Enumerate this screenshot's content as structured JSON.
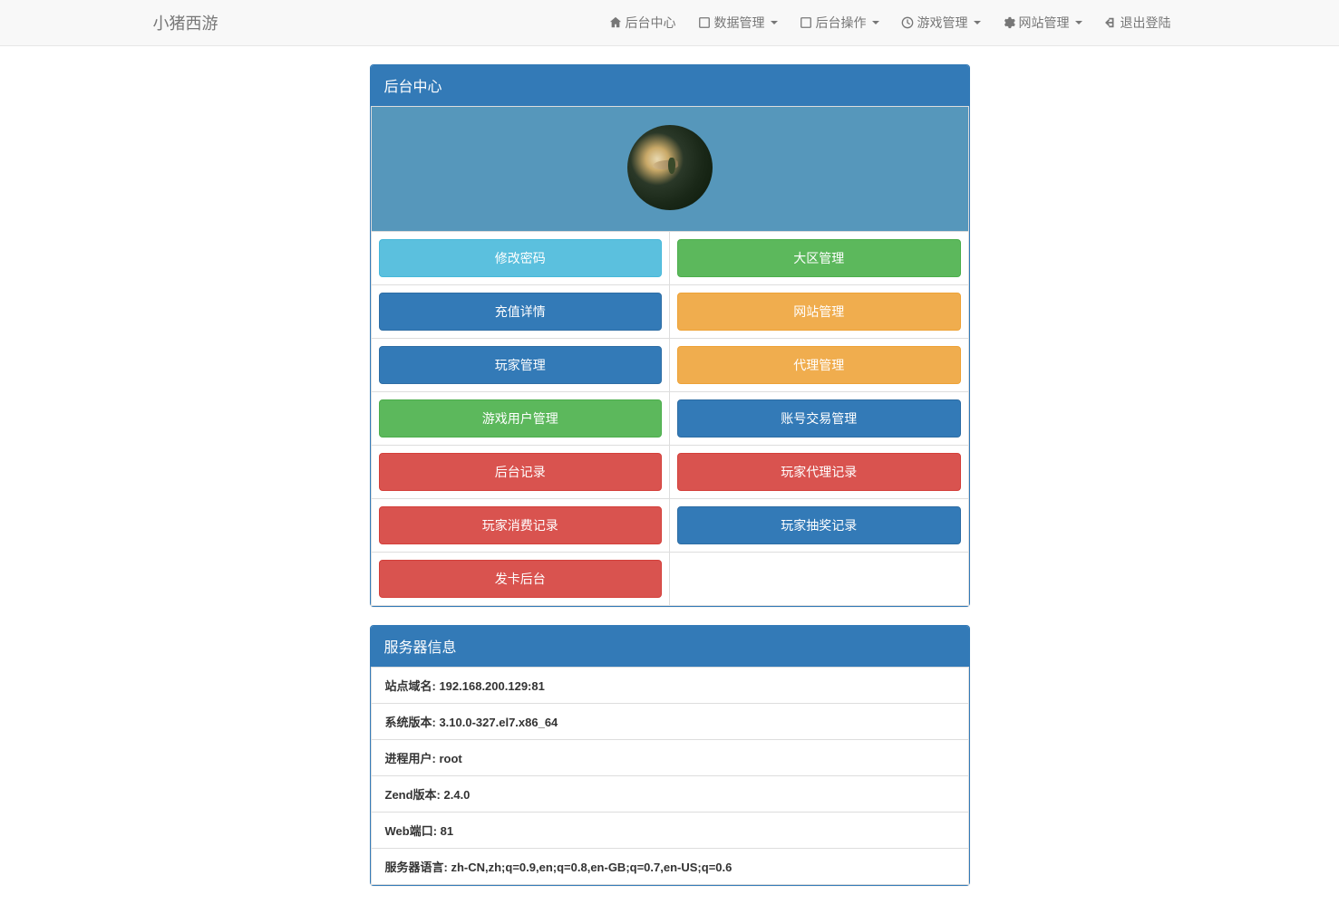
{
  "navbar": {
    "brand": "小猪西游",
    "items": [
      {
        "icon": "home",
        "label": "后台中心",
        "dropdown": false
      },
      {
        "icon": "unchecked",
        "label": "数据管理",
        "dropdown": true
      },
      {
        "icon": "unchecked",
        "label": "后台操作",
        "dropdown": true
      },
      {
        "icon": "time",
        "label": "游戏管理",
        "dropdown": true
      },
      {
        "icon": "cog",
        "label": "网站管理",
        "dropdown": true
      },
      {
        "icon": "logout",
        "label": "退出登陆",
        "dropdown": false
      }
    ]
  },
  "panel1": {
    "title": "后台中心",
    "buttons": [
      [
        {
          "label": "修改密码",
          "cls": "btn-info"
        },
        {
          "label": "大区管理",
          "cls": "btn-success"
        }
      ],
      [
        {
          "label": "充值详情",
          "cls": "btn-primary"
        },
        {
          "label": "网站管理",
          "cls": "btn-warning"
        }
      ],
      [
        {
          "label": "玩家管理",
          "cls": "btn-primary"
        },
        {
          "label": "代理管理",
          "cls": "btn-warning"
        }
      ],
      [
        {
          "label": "游戏用户管理",
          "cls": "btn-success"
        },
        {
          "label": "账号交易管理",
          "cls": "btn-primary"
        }
      ],
      [
        {
          "label": "后台记录",
          "cls": "btn-danger"
        },
        {
          "label": "玩家代理记录",
          "cls": "btn-danger"
        }
      ],
      [
        {
          "label": "玩家消费记录",
          "cls": "btn-danger"
        },
        {
          "label": "玩家抽奖记录",
          "cls": "btn-primary"
        }
      ],
      [
        {
          "label": "发卡后台",
          "cls": "btn-danger"
        },
        null
      ]
    ]
  },
  "panel2": {
    "title": "服务器信息",
    "items": [
      {
        "label": "站点域名: ",
        "value": "192.168.200.129:81"
      },
      {
        "label": "系统版本: ",
        "value": "3.10.0-327.el7.x86_64"
      },
      {
        "label": "进程用户: ",
        "value": "root"
      },
      {
        "label": "Zend版本: ",
        "value": "2.4.0"
      },
      {
        "label": "Web端口: ",
        "value": "81"
      },
      {
        "label": "服务器语言: ",
        "value": "zh-CN,zh;q=0.9,en;q=0.8,en-GB;q=0.7,en-US;q=0.6"
      }
    ]
  }
}
